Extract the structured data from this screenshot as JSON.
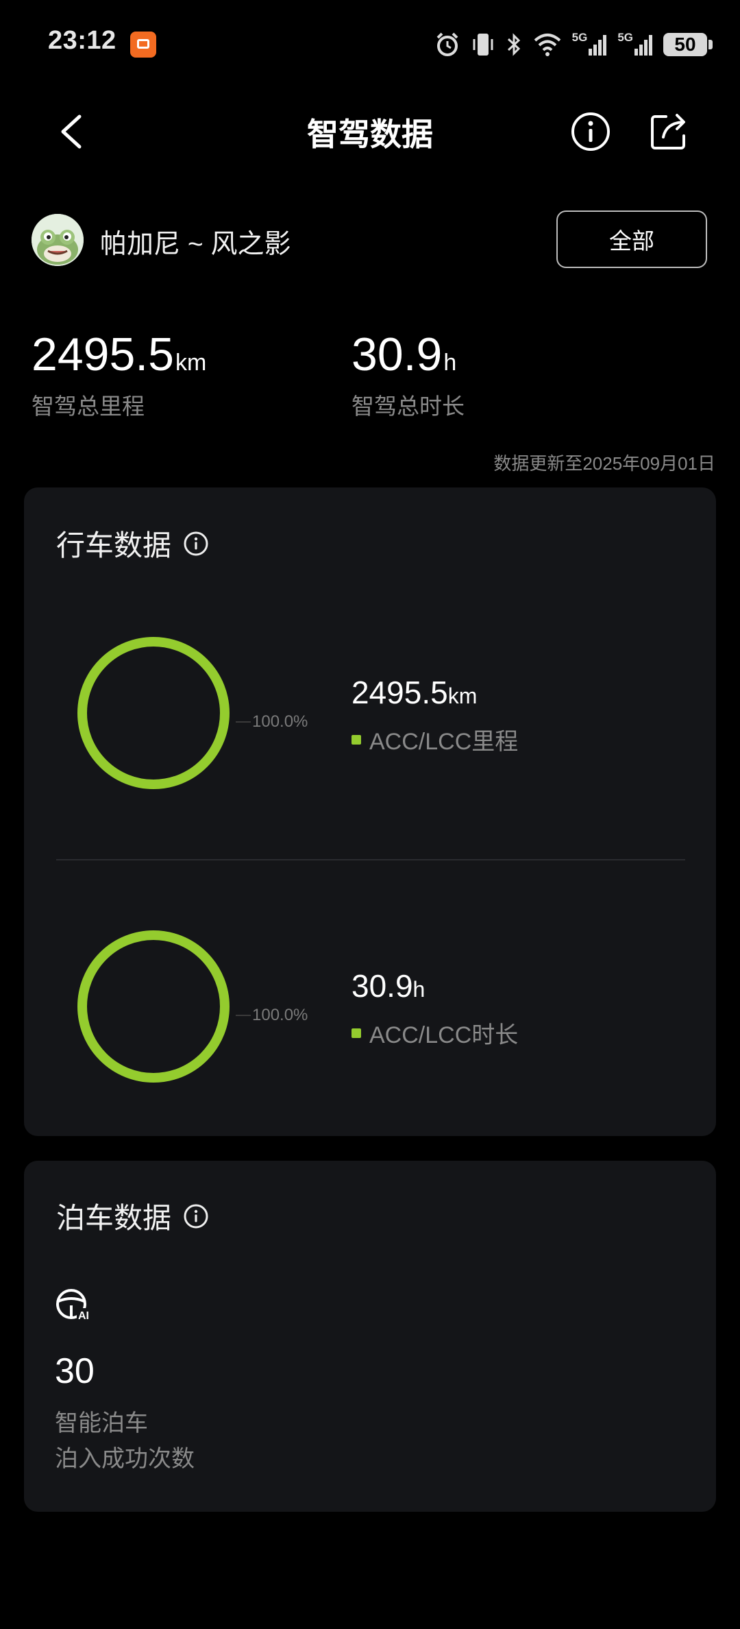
{
  "status_bar": {
    "time": "23:12",
    "network_1": "5G",
    "network_2": "5G",
    "battery": "50"
  },
  "header": {
    "title": "智驾数据"
  },
  "user": {
    "name": "帕加尼 ~ 风之影",
    "filter_label": "全部"
  },
  "totals": {
    "mileage_value": "2495.5",
    "mileage_unit": "km",
    "mileage_label": "智驾总里程",
    "duration_value": "30.9",
    "duration_unit": "h",
    "duration_label": "智驾总时长",
    "update_note": "数据更新至2025年09月01日"
  },
  "driving": {
    "title": "行车数据",
    "accent_color": "#94cc2e",
    "items": [
      {
        "percent_label": "100.0%",
        "percent": 100,
        "value": "2495.5",
        "unit": "km",
        "legend": "ACC/LCC里程"
      },
      {
        "percent_label": "100.0%",
        "percent": 100,
        "value": "30.9",
        "unit": "h",
        "legend": "ACC/LCC时长"
      }
    ]
  },
  "parking": {
    "title": "泊车数据",
    "icon": "steering-ai-icon",
    "count": "30",
    "label_1": "智能泊车",
    "label_2": "泊入成功次数"
  }
}
